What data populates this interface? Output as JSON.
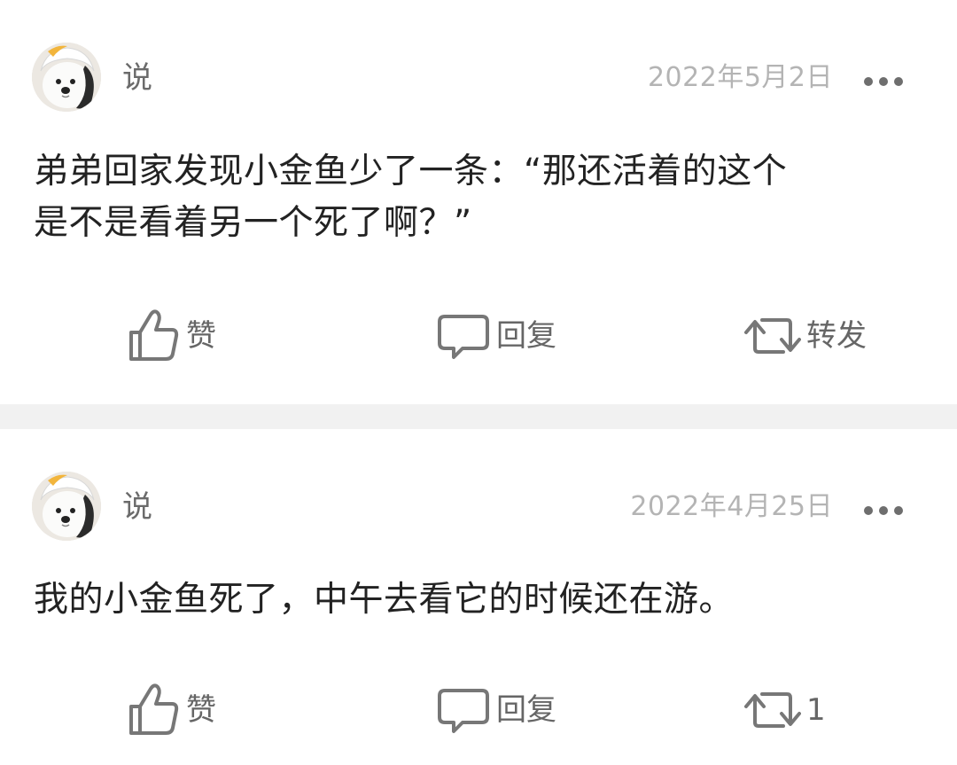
{
  "posts": [
    {
      "username": "说",
      "date": "2022年5月2日",
      "content": "弟弟回家发现小金鱼少了一条：“那还活着的这个\n是不是看着另一个死了啊？”",
      "like_label": "赞",
      "reply_label": "回复",
      "share_label": "转发",
      "avatar_icon": "white-dog-avatar"
    },
    {
      "username": "说",
      "date": "2022年4月25日",
      "content": "我的小金鱼死了，中午去看它的时候还在游。",
      "like_label": "赞",
      "reply_label": "回复",
      "share_label": "1",
      "avatar_icon": "white-dog-avatar"
    }
  ],
  "colors": {
    "text_primary": "#222222",
    "text_secondary": "#666666",
    "text_muted": "#b4b4b4",
    "divider": "#f1f1f1"
  },
  "icons": {
    "more": "more-dots-icon",
    "like": "thumbs-up-icon",
    "reply": "comment-bubble-icon",
    "share": "repost-arrows-icon"
  }
}
